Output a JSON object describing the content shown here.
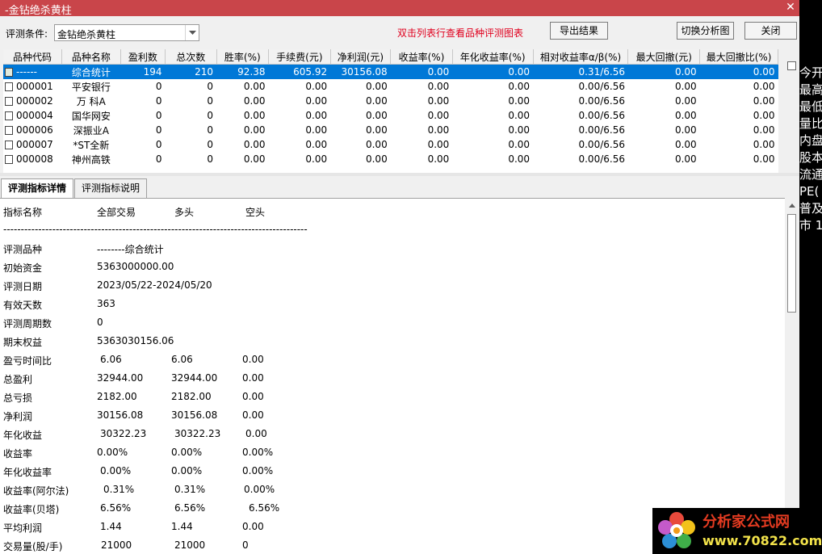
{
  "window": {
    "title": "-金钻绝杀黄柱",
    "close_glyph": "✕"
  },
  "toolbar": {
    "condition_label": "评测条件:",
    "condition_value": "金钻绝杀黄柱",
    "hint": "双击列表行查看品种评测图表",
    "export_label": "导出结果",
    "switch_label": "切换分析图",
    "close_label": "关闭"
  },
  "grid": {
    "columns": [
      "品种代码",
      "品种名称",
      "盈利数",
      "总次数",
      "胜率(%)",
      "手续费(元)",
      "净利润(元)",
      "收益率(%)",
      "年化收益率(%)",
      "相对收益率α/β(%)",
      "最大回撤(元)",
      "最大回撤比(%)"
    ],
    "rows": [
      {
        "selected": true,
        "icon": "summary",
        "cells": [
          "------",
          "综合统计",
          "194",
          "210",
          "92.38",
          "605.92",
          "30156.08",
          "0.00",
          "0.00",
          "0.31/6.56",
          "0.00",
          "0.00"
        ]
      },
      {
        "selected": false,
        "icon": "checkbox",
        "cells": [
          "000001",
          "平安银行",
          "0",
          "0",
          "0.00",
          "0.00",
          "0.00",
          "0.00",
          "0.00",
          "0.00/6.56",
          "0.00",
          "0.00"
        ]
      },
      {
        "selected": false,
        "icon": "checkbox",
        "cells": [
          "000002",
          "万 科A",
          "0",
          "0",
          "0.00",
          "0.00",
          "0.00",
          "0.00",
          "0.00",
          "0.00/6.56",
          "0.00",
          "0.00"
        ]
      },
      {
        "selected": false,
        "icon": "checkbox",
        "cells": [
          "000004",
          "国华网安",
          "0",
          "0",
          "0.00",
          "0.00",
          "0.00",
          "0.00",
          "0.00",
          "0.00/6.56",
          "0.00",
          "0.00"
        ]
      },
      {
        "selected": false,
        "icon": "checkbox",
        "cells": [
          "000006",
          "深振业A",
          "0",
          "0",
          "0.00",
          "0.00",
          "0.00",
          "0.00",
          "0.00",
          "0.00/6.56",
          "0.00",
          "0.00"
        ]
      },
      {
        "selected": false,
        "icon": "checkbox",
        "cells": [
          "000007",
          "*ST全新",
          "0",
          "0",
          "0.00",
          "0.00",
          "0.00",
          "0.00",
          "0.00",
          "0.00/6.56",
          "0.00",
          "0.00"
        ]
      },
      {
        "selected": false,
        "icon": "checkbox",
        "cells": [
          "000008",
          "神州高铁",
          "0",
          "0",
          "0.00",
          "0.00",
          "0.00",
          "0.00",
          "0.00",
          "0.00/6.56",
          "0.00",
          "0.00"
        ]
      }
    ]
  },
  "tabs": [
    "评测指标详情",
    "评测指标说明"
  ],
  "detail": {
    "header": [
      "指标名称",
      "全部交易",
      "多头",
      "空头"
    ],
    "separator": "---------------------------------------------------------------------------------------",
    "rows": [
      [
        "评测品种",
        "--------综合统计",
        "",
        ""
      ],
      [
        "初始资金",
        "5363000000.00",
        "",
        ""
      ],
      [
        "评测日期",
        "2023/05/22-2024/05/20",
        "",
        ""
      ],
      [
        "有效天数",
        "363",
        "",
        ""
      ],
      [
        "评测周期数",
        "0",
        "",
        ""
      ],
      [
        "期末权益",
        "5363030156.06",
        "",
        ""
      ],
      [
        "盈亏时间比",
        "6.06",
        "6.06",
        "0.00"
      ],
      [
        "总盈利",
        "32944.00",
        "32944.00",
        "0.00"
      ],
      [
        "总亏损",
        "2182.00",
        "2182.00",
        "0.00"
      ],
      [
        "净利润",
        "30156.08",
        "30156.08",
        "0.00"
      ],
      [
        "年化收益",
        "30322.23",
        "30322.23",
        "0.00"
      ],
      [
        "收益率",
        "0.00%",
        "0.00%",
        "0.00%"
      ],
      [
        "年化收益率",
        "0.00%",
        "0.00%",
        "0.00%"
      ],
      [
        "收益率(阿尔法)",
        "0.31%",
        "0.31%",
        "0.00%"
      ],
      [
        "收益率(贝塔)",
        "6.56%",
        "6.56%",
        "6.56%"
      ],
      [
        "平均利润",
        "1.44",
        "1.44",
        "0.00"
      ],
      [
        "交易量(股/手)",
        "21000",
        "21000",
        "0"
      ]
    ]
  },
  "right_panel": [
    "今开",
    "最高",
    "最低",
    "量比",
    "内盘",
    "股本",
    "流通",
    "PE(",
    "普及",
    "市 1"
  ],
  "watermark": {
    "line1": "分析家公式网",
    "line2": "www.70822.com"
  }
}
